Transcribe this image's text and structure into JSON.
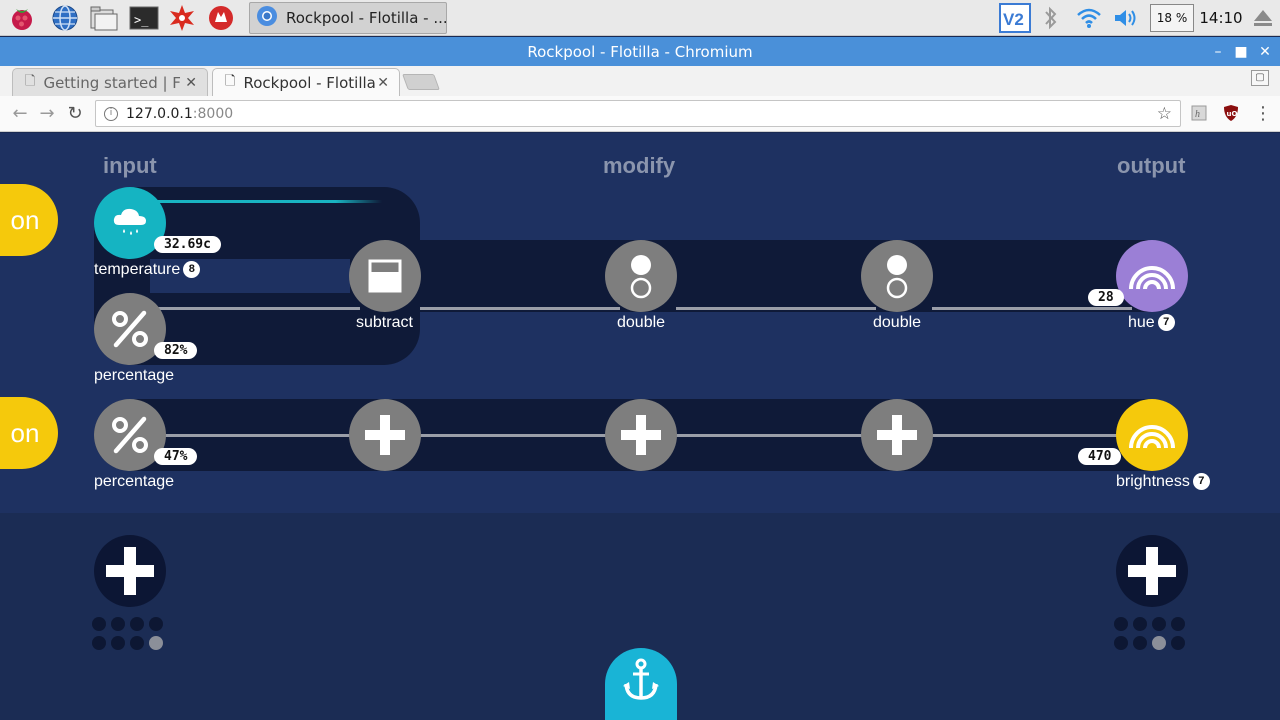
{
  "taskbar": {
    "task_title": "Rockpool - Flotilla - ...",
    "cpu": "18 %",
    "clock": "14:10"
  },
  "window": {
    "title": "Rockpool - Flotilla - Chromium"
  },
  "tabs": [
    {
      "label": "Getting started | F"
    },
    {
      "label": "Rockpool - Flotilla"
    }
  ],
  "toolbar": {
    "url_host": "127.0.0.1",
    "url_port": ":8000"
  },
  "columns": {
    "input": "input",
    "modify": "modify",
    "output": "output"
  },
  "chain1": {
    "on_label": "on",
    "temperature": {
      "label": "temperature",
      "badge": "8",
      "value": "32.69c"
    },
    "percentage": {
      "label": "percentage",
      "value": "82%"
    },
    "subtract": {
      "label": "subtract"
    },
    "double1": {
      "label": "double"
    },
    "double2": {
      "label": "double"
    },
    "hue": {
      "label": "hue",
      "badge": "7",
      "value": "28"
    }
  },
  "chain2": {
    "on_label": "on",
    "percentage": {
      "label": "percentage",
      "value": "47%"
    },
    "brightness": {
      "label": "brightness",
      "badge": "7",
      "value": "470"
    }
  },
  "colors": {
    "on_button": "#f5c90c",
    "temperature_node": "#15b4c2",
    "hue_node": "#9b7fd6",
    "brightness_node": "#f5c90c",
    "anchor": "#19b4d6"
  },
  "icons": {
    "temperature": "rain-cloud-icon",
    "percentage": "percent-icon",
    "subtract": "subtract-icon",
    "double": "double-icon",
    "add": "plus-icon",
    "hue": "rainbow-icon",
    "anchor": "anchor-icon"
  },
  "paging": {
    "input_dots_active": 8,
    "output_dots_active": 7
  }
}
